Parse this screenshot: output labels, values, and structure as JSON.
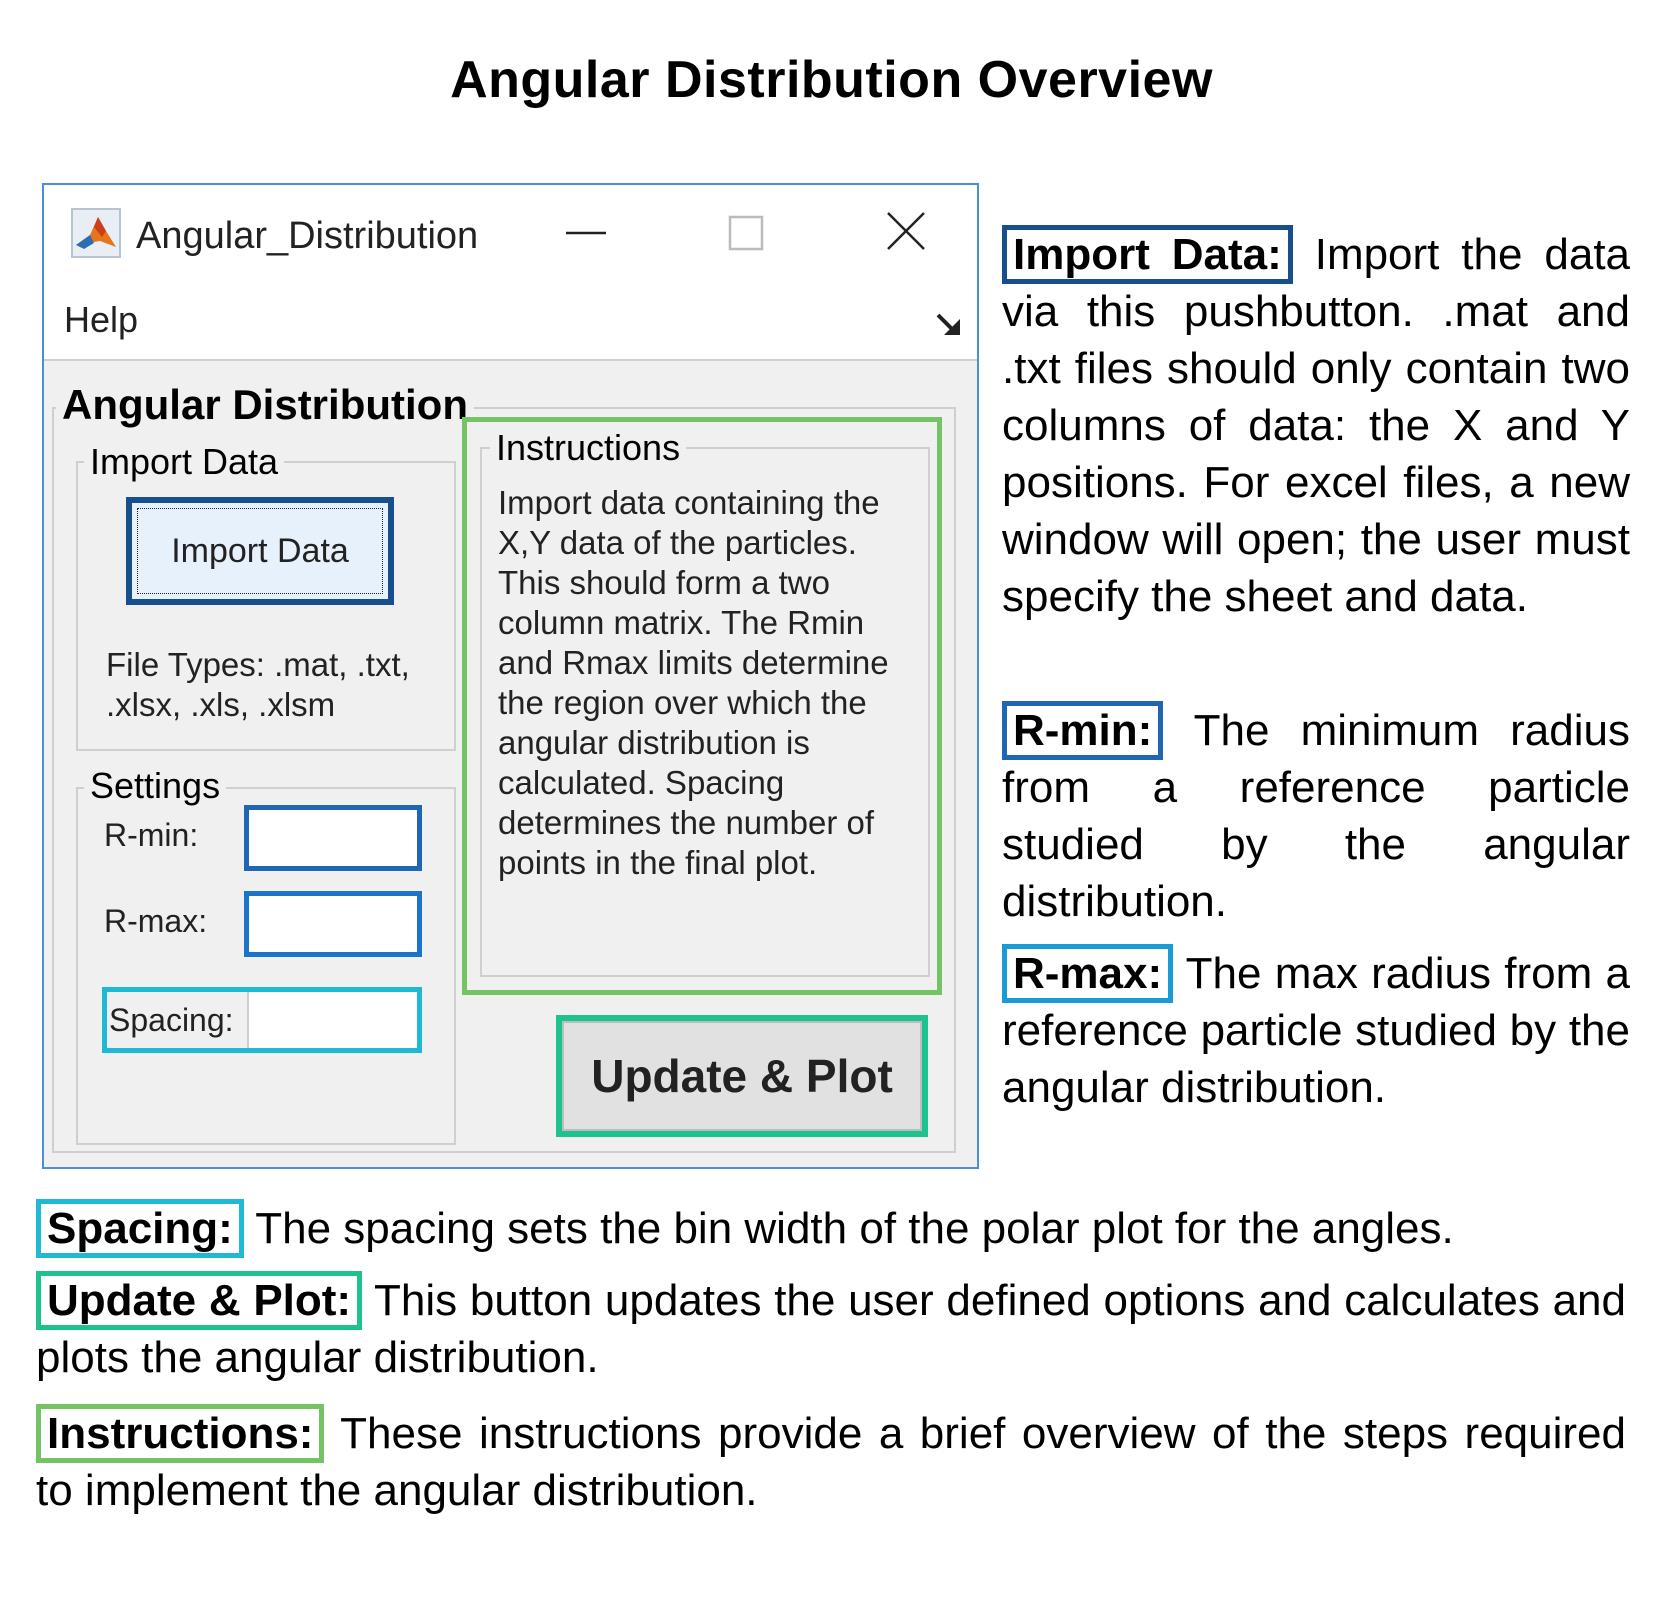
{
  "page": {
    "title": "Angular Distribution Overview"
  },
  "window": {
    "title": "Angular_Distribution",
    "menu": [
      "Help"
    ],
    "colors": {
      "titlebar_border": "#4a90d9",
      "background": "#f0f0f0"
    }
  },
  "app": {
    "main_panel_title": "Angular Distribution",
    "import_panel": {
      "title": "Import Data",
      "button_label": "Import Data",
      "file_types": "File Types:  .mat, .txt, .xlsx, .xls, .xlsm"
    },
    "settings_panel": {
      "title": "Settings",
      "rmin_label": "R-min:",
      "rmin_value": "",
      "rmax_label": "R-max:",
      "rmax_value": "",
      "spacing_label": "Spacing:",
      "spacing_value": ""
    },
    "instructions": {
      "title": "Instructions",
      "text": "Import data containing the X,Y data of the particles. This should form a two column matrix. The Rmin and Rmax limits determine the region over which the angular distribution is calculated. Spacing determines the number of points in the final plot."
    },
    "update_button_label": "Update & Plot"
  },
  "descriptions": {
    "import": {
      "tag": "Import Data:",
      "text": " Import the data via this pushbutton. .mat and .txt files should only contain two columns of data: the X and Y positions.  For excel files, a new window will open; the user must specify the sheet and data."
    },
    "rmin": {
      "tag": "R-min:",
      "text": "  The minimum radius from a reference particle studied by the angular distribution."
    },
    "rmax": {
      "tag": "R-max:",
      "text": " The max radius from a reference particle studied by the angular distribution."
    },
    "spacing": {
      "tag": "Spacing:",
      "text": "  The spacing sets the bin width of the polar plot for the angles."
    },
    "update": {
      "tag": "Update & Plot:",
      "text": "  This button updates the user defined options and calculates and plots the angular distribution."
    },
    "instructions": {
      "tag": "Instructions:",
      "text": "  These instructions provide a brief overview of the steps required to implement the angular distribution."
    }
  },
  "highlight_colors": {
    "import": "#164f8c",
    "rmin": "#1f66b3",
    "rmax": "#1a9ad6",
    "spacing": "#1fb9d6",
    "update": "#1ec28f",
    "instructions": "#74c365"
  },
  "icons": [
    "matlab-icon",
    "minimize-icon",
    "maximize-icon",
    "close-icon",
    "dock-arrow-icon"
  ]
}
